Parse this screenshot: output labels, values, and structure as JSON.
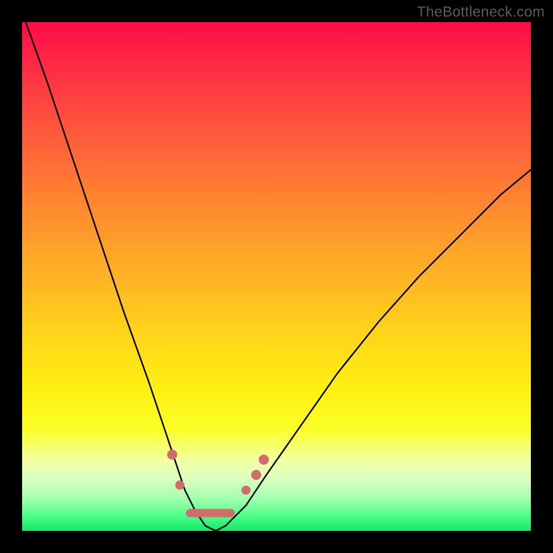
{
  "watermark": "TheBottleneck.com",
  "chart_data": {
    "type": "line",
    "title": "",
    "xlabel": "",
    "ylabel": "",
    "xlim": [
      0,
      100
    ],
    "ylim": [
      0,
      100
    ],
    "grid": false,
    "legend": false,
    "series": [
      {
        "name": "curve",
        "x": [
          0,
          5,
          10,
          15,
          20,
          25,
          28,
          30,
          32,
          34,
          36,
          38,
          40,
          44,
          48,
          55,
          62,
          70,
          78,
          86,
          94,
          100
        ],
        "y": [
          102,
          88,
          73,
          58,
          43,
          29,
          20,
          14,
          8,
          4,
          1,
          0,
          1,
          5,
          11,
          21,
          31,
          41,
          50,
          58,
          66,
          71
        ]
      }
    ],
    "markers": [
      {
        "name": "left-upper-dot",
        "x": 29.5,
        "y": 15,
        "r": 1.1
      },
      {
        "name": "left-lower-dot",
        "x": 31.0,
        "y": 9,
        "r": 1.0
      },
      {
        "name": "right-lower-dot",
        "x": 44.0,
        "y": 8,
        "r": 1.0
      },
      {
        "name": "right-mid-dot",
        "x": 46.0,
        "y": 11,
        "r": 1.1
      },
      {
        "name": "right-upper-dot",
        "x": 47.5,
        "y": 14,
        "r": 1.1
      }
    ],
    "bottom_segment": {
      "x1": 33,
      "y1": 3.5,
      "x2": 41,
      "y2": 3.5
    },
    "gradient_stops": [
      {
        "pos": 0,
        "color": "#ff0b49"
      },
      {
        "pos": 18,
        "color": "#ff4c3e"
      },
      {
        "pos": 46,
        "color": "#ffa727"
      },
      {
        "pos": 72,
        "color": "#fff011"
      },
      {
        "pos": 90,
        "color": "#d8ffc2"
      },
      {
        "pos": 100,
        "color": "#15e76a"
      }
    ]
  }
}
